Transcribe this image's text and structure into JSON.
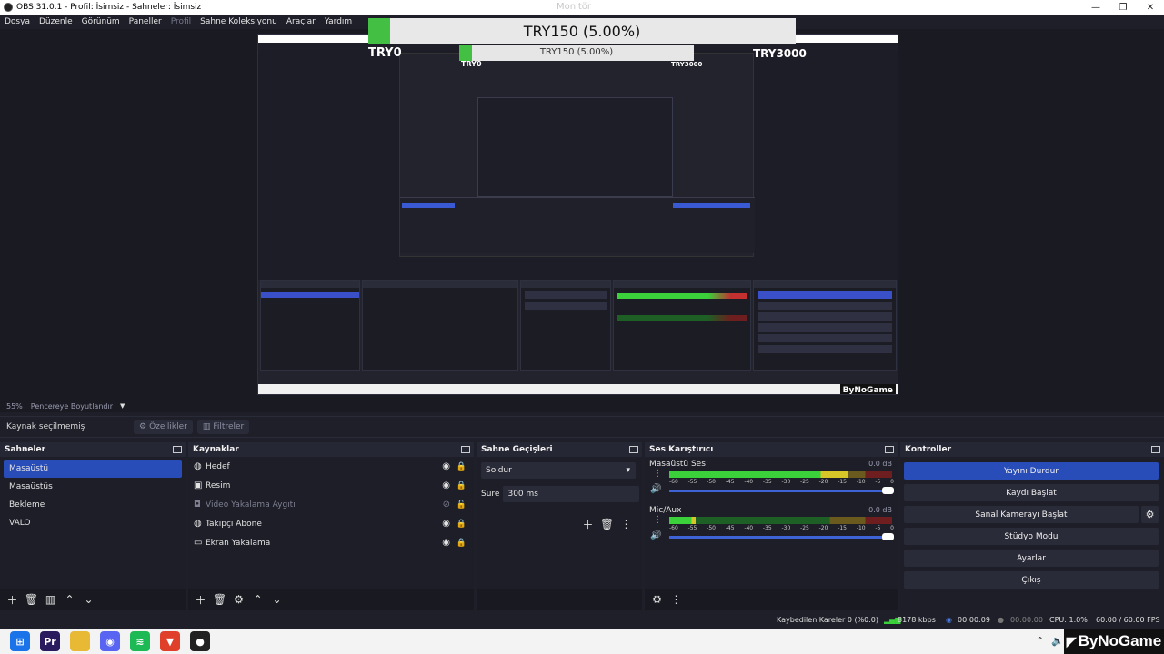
{
  "window": {
    "title": "OBS 31.0.1 - Profil: İsimsiz - Sahneler: İsimsiz",
    "center_title": "Monitör",
    "minimize": "—",
    "maximize": "❐",
    "close": "✕"
  },
  "menu": {
    "items": [
      {
        "label": "Dosya"
      },
      {
        "label": "Düzenle"
      },
      {
        "label": "Görünüm"
      },
      {
        "label": "Paneller"
      },
      {
        "label": "Profil"
      },
      {
        "label": "Sahne Koleksiyonu"
      },
      {
        "label": "Araçlar"
      },
      {
        "label": "Yardım"
      }
    ]
  },
  "donation": {
    "text": "TRY150 (5.00%)",
    "min": "TRY0",
    "max": "TRY3000",
    "progress": 0.05,
    "color": "#43c043"
  },
  "donation_nested": {
    "text": "TRY150 (5.00%)",
    "min": "TRY0",
    "max": "TRY3000"
  },
  "preview_brand": "ByNoGame",
  "zoom": {
    "value": "55%",
    "label": "Pencereye Boyutlandır",
    "caret": "▼"
  },
  "source_toolbar": {
    "no_selection": "Kaynak seçilmemiş",
    "properties": "Özellikler",
    "filters": "Filtreler"
  },
  "scenes": {
    "title": "Sahneler",
    "items": [
      {
        "label": "Masaüstü",
        "selected": true
      },
      {
        "label": "Masaüstüs",
        "selected": false
      },
      {
        "label": "Bekleme",
        "selected": false
      },
      {
        "label": "VALO",
        "selected": false
      }
    ]
  },
  "sources": {
    "title": "Kaynaklar",
    "items": [
      {
        "label": "Hedef",
        "icon": "globe-icon"
      },
      {
        "label": "Resim",
        "icon": "image-icon"
      },
      {
        "label": "Video Yakalama Aygıtı",
        "icon": "camera-icon",
        "hidden": true
      },
      {
        "label": "Takipçi Abone",
        "icon": "globe-icon"
      },
      {
        "label": "Ekran Yakalama",
        "icon": "monitor-icon"
      }
    ]
  },
  "transitions": {
    "title": "Sahne Geçişleri",
    "selected": "Soldur",
    "duration_label": "Süre",
    "duration_value": "300 ms"
  },
  "mixer": {
    "title": "Ses Karıştırıcı",
    "channels": [
      {
        "name": "Masaüstü Ses",
        "db": "0.0 dB",
        "level": 0.8
      },
      {
        "name": "Mic/Aux",
        "db": "0.0 dB",
        "level": 0.12
      }
    ],
    "scale": [
      "-60",
      "-55",
      "-50",
      "-45",
      "-40",
      "-35",
      "-30",
      "-25",
      "-20",
      "-15",
      "-10",
      "-5",
      "0"
    ]
  },
  "controls": {
    "title": "Kontroller",
    "stop_stream": "Yayını Durdur",
    "start_record": "Kaydı Başlat",
    "virtual_cam": "Sanal Kamerayı Başlat",
    "studio_mode": "Stüdyo Modu",
    "settings": "Ayarlar",
    "exit": "Çıkış"
  },
  "status": {
    "dropped": "Kaybedilen Kareler 0 (%0.0)",
    "bitrate": "8178 kbps",
    "stream_time": "00:00:09",
    "record_time": "00:00:00",
    "cpu": "CPU: 1.0%",
    "fps": "60.00 / 60.00 FPS"
  },
  "taskbar": {
    "brand": "ByNoGame",
    "apps": [
      {
        "icon": "windows-icon",
        "color": "#1a73e8",
        "glyph": "⊞"
      },
      {
        "icon": "premiere-icon",
        "color": "#2a1a5e",
        "glyph": "Pr"
      },
      {
        "icon": "folder-icon",
        "color": "#e8b935",
        "glyph": ""
      },
      {
        "icon": "discord-icon",
        "color": "#5865f2",
        "glyph": "◉"
      },
      {
        "icon": "spotify-icon",
        "color": "#1db954",
        "glyph": "≋"
      },
      {
        "icon": "brave-icon",
        "color": "#e0402a",
        "glyph": "▼"
      },
      {
        "icon": "obs-icon",
        "color": "#222222",
        "glyph": "●"
      }
    ]
  }
}
